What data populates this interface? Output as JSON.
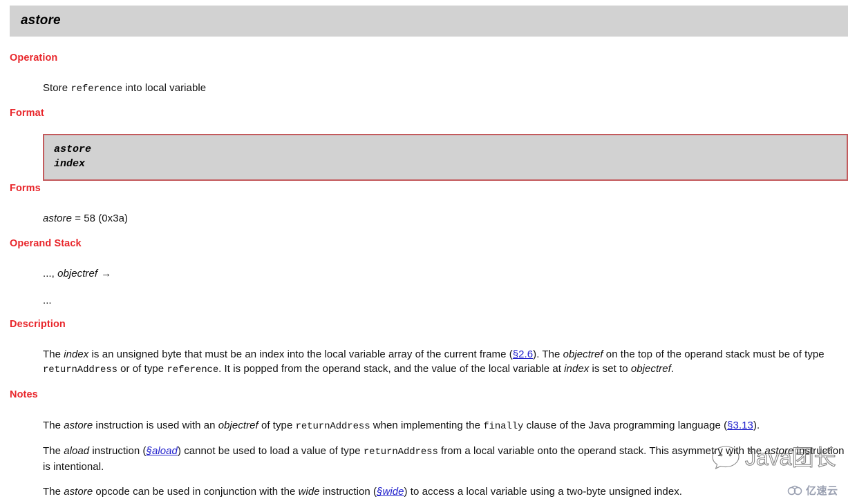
{
  "document": {
    "title": "astore",
    "instruction_name": "astore"
  },
  "sections": {
    "operation": {
      "heading": "Operation",
      "text_before": "Store ",
      "code": "reference",
      "text_after": " into local variable"
    },
    "format": {
      "heading": "Format",
      "lines": [
        "astore",
        "index"
      ]
    },
    "forms": {
      "heading": "Forms",
      "mnemonic": "astore",
      "value": " = 58 (0x3a)"
    },
    "operand_stack": {
      "heading": "Operand Stack",
      "before_prefix": "..., ",
      "before_item": "objectref",
      "arrow": "→",
      "after": "..."
    },
    "description": {
      "heading": "Description",
      "p1": {
        "t1": "The ",
        "i1": "index",
        "t2": " is an unsigned byte that must be an index into the local variable array of the current frame (",
        "link1": "§2.6",
        "t3": "). The ",
        "i2": "objectref",
        "t4": " on the top of the operand stack must be of type ",
        "c1": "returnAddress",
        "t5": " or of type ",
        "c2": "reference",
        "t6": ". It is popped from the operand stack, and the value of the local variable at ",
        "i3": "index",
        "t7": " is set to ",
        "i4": "objectref",
        "t8": "."
      }
    },
    "notes": {
      "heading": "Notes",
      "p1": {
        "t1": "The ",
        "i1": "astore",
        "t2": " instruction is used with an ",
        "i2": "objectref",
        "t3": " of type ",
        "c1": "returnAddress",
        "t4": " when implementing the ",
        "c2": "finally",
        "t5": " clause of the Java programming language (",
        "link1": "§3.13",
        "t6": ")."
      },
      "p2": {
        "t1": "The ",
        "i1": "aload",
        "t2": " instruction (",
        "link1": "§aload",
        "t3": ") cannot be used to load a value of type ",
        "c1": "returnAddress",
        "t4": " from a local variable onto the operand stack. This asymmetry with the ",
        "i2": "astore",
        "t5": " instruction is intentional."
      },
      "p3": {
        "t1": "The ",
        "i1": "astore",
        "t2": " opcode can be used in conjunction with the ",
        "i2": "wide",
        "t3": " instruction (",
        "link1": "§wide",
        "t4": ") to access a local variable using a two-byte unsigned index."
      }
    }
  },
  "watermarks": {
    "java": "Java团长",
    "cloud": "亿速云"
  },
  "colors": {
    "heading": "#e8262b",
    "title_bar_bg": "#d2d2d2",
    "format_border": "#c35a5c",
    "format_bg": "#d2d2d2",
    "link": "#2222cc",
    "cloud_watermark": "#8e95a8"
  }
}
